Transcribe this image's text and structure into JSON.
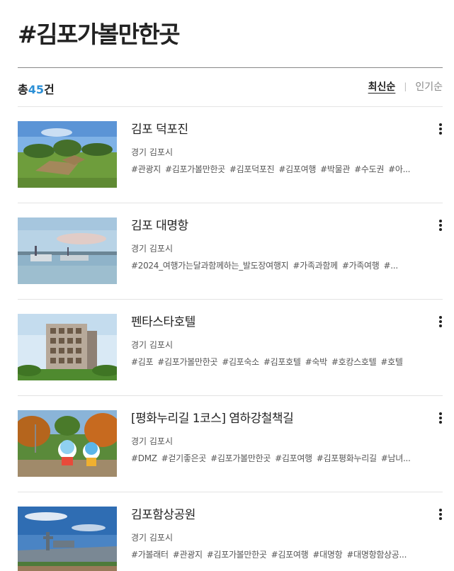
{
  "header": {
    "title": "#김포가볼만한곳"
  },
  "summary": {
    "prefix": "총",
    "count": "45",
    "suffix": "건"
  },
  "sort": {
    "options": [
      "최신순",
      "인기순"
    ],
    "active": "최신순",
    "separator": "|"
  },
  "items": [
    {
      "title": "김포 덕포진",
      "region": "경기 김포시",
      "tags": [
        "#관광지",
        "#김포가볼만한곳",
        "#김포덕포진",
        "#김포여행",
        "#박물관",
        "#수도권",
        "#아..."
      ]
    },
    {
      "title": "김포 대명항",
      "region": "경기 김포시",
      "tags": [
        "#2024_여행가는달과함께하는_발도장여행지",
        "#가족과함께",
        "#가족여행",
        "#..."
      ]
    },
    {
      "title": "펜타스타호텔",
      "region": "경기 김포시",
      "tags": [
        "#김포",
        "#김포가볼만한곳",
        "#김포숙소",
        "#김포호텔",
        "#숙박",
        "#호캉스호텔",
        "#호텔"
      ]
    },
    {
      "title": "[평화누리길 1코스] 염하강철책길",
      "region": "경기 김포시",
      "tags": [
        "#DMZ",
        "#걷기좋은곳",
        "#김포가볼만한곳",
        "#김포여행",
        "#김포평화누리길",
        "#남녀..."
      ]
    },
    {
      "title": "김포함상공원",
      "region": "경기 김포시",
      "tags": [
        "#가볼래터",
        "#관광지",
        "#김포가볼만한곳",
        "#김포여행",
        "#대명항",
        "#대명항함상공..."
      ]
    }
  ]
}
